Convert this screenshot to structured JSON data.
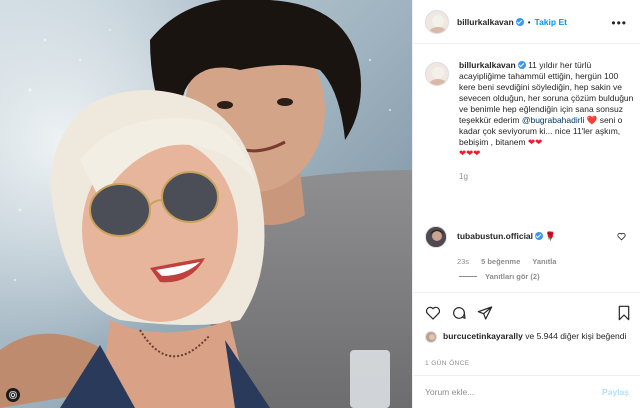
{
  "post": {
    "username": "billurkalkavan",
    "verified": true,
    "follow_label": "Takip Et",
    "separator": "•",
    "more_icon": "more-horizontal-icon",
    "caption": {
      "text_part1": "11 yıldır her türlü acayipliğime tahammül ettiğin, hergün 100 kere beni sevdiğini söylediğin, hep sakin ve sevecen olduğun, her soruna çözüm bulduğun ve benimle hep eğlendiğin için sana sonsuz teşekkür ederim ",
      "mention": "@bugrabahadirli",
      "text_part2": " seni o kadar çok seviyorum ki... nice 11'ler aşkım, bebişim , bitanem ",
      "hearts_inline": "❤️",
      "hearts_end": "❤❤",
      "hearts_row": "❤❤❤",
      "time": "1g"
    },
    "comment": {
      "username": "tubabustun.official",
      "verified": true,
      "emoji": "🌹",
      "time": "23s",
      "likes_label": "5 beğenme",
      "reply_label": "Yanıtla",
      "view_replies_label": "Yanıtları gör (2)"
    },
    "likes": {
      "liker": "burcucetinkayarally",
      "others_text": "ve 5.944 diğer kişi beğendi"
    },
    "post_time": "1 GÜN ÖNCE",
    "input": {
      "placeholder": "Yorum ekle...",
      "post_label": "Paylaş"
    },
    "colors": {
      "accent_blue": "#0095f6",
      "verified_blue": "#3897f0",
      "mention_blue": "#00376b",
      "heart_red": "#ed1c2e",
      "muted_gray": "#8e8e8e"
    }
  }
}
